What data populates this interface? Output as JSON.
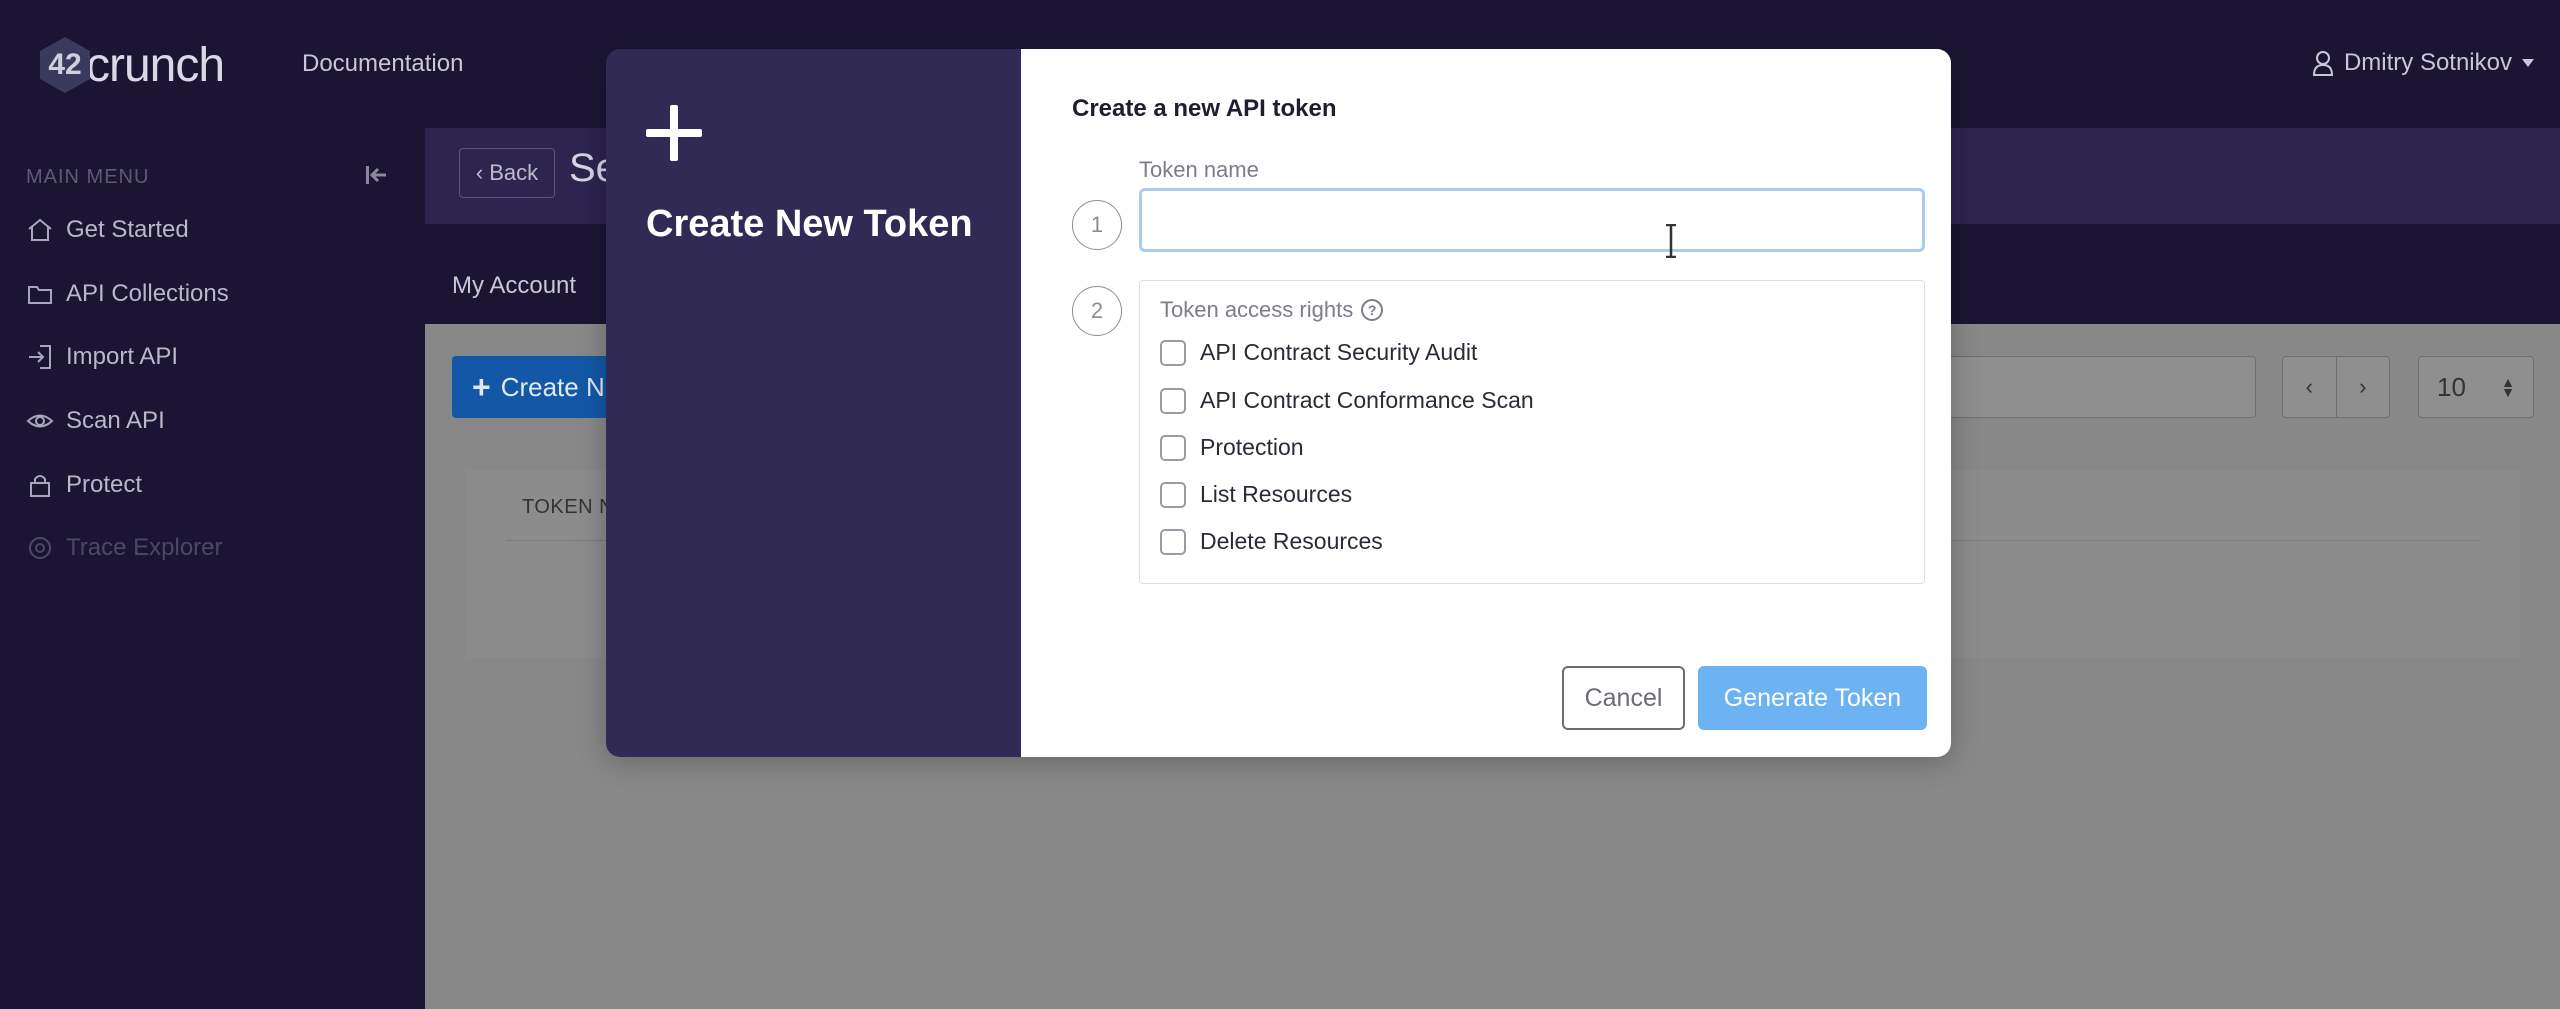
{
  "topbar": {
    "logo_prefix": "42",
    "logo_text": "crunch",
    "documentation_link": "Documentation",
    "user_name": "Dmitry Sotnikov"
  },
  "sidebar": {
    "menu_title": "MAIN MENU",
    "items": [
      {
        "label": "Get Started",
        "icon": "home-icon"
      },
      {
        "label": "API Collections",
        "icon": "folder-icon"
      },
      {
        "label": "Import API",
        "icon": "import-icon"
      },
      {
        "label": "Scan API",
        "icon": "eye-icon"
      },
      {
        "label": "Protect",
        "icon": "lock-icon"
      },
      {
        "label": "Trace Explorer",
        "icon": "trace-icon",
        "disabled": true
      }
    ]
  },
  "content": {
    "back_label": "Back",
    "page_title_partial": "Se",
    "tab_account": "My Account",
    "create_button_partial": "Create N",
    "pager_prev": "‹",
    "pager_next": "›",
    "per_page": "10",
    "table_header_partial": "TOKEN N"
  },
  "modal": {
    "left_title": "Create New Token",
    "heading": "Create a new API token",
    "step1": "1",
    "step2": "2",
    "token_name_label": "Token name",
    "token_name_value": "",
    "access_rights_label": "Token access rights",
    "rights": [
      {
        "label": "API Contract Security Audit",
        "checked": false
      },
      {
        "label": "API Contract Conformance Scan",
        "checked": false
      },
      {
        "label": "Protection",
        "checked": false
      },
      {
        "label": "List Resources",
        "checked": false
      },
      {
        "label": "Delete Resources",
        "checked": false
      }
    ],
    "cancel_label": "Cancel",
    "generate_label": "Generate Token"
  },
  "colors": {
    "nav_background": "#1b1533",
    "modal_left_background": "#312a54",
    "primary_button": "#6db3f4",
    "focus_border": "#a9cbef"
  }
}
